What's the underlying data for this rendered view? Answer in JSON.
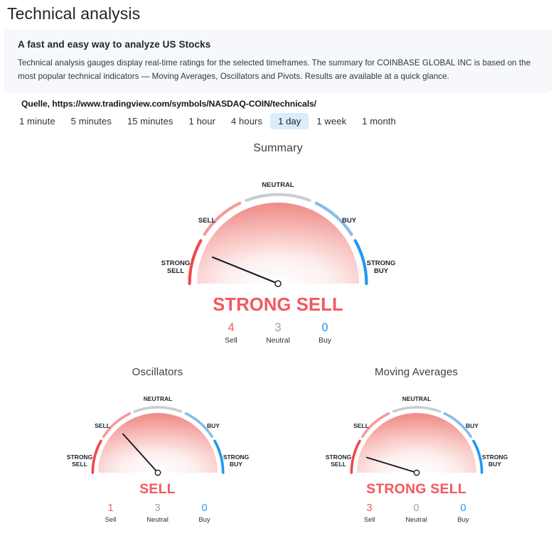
{
  "page_title": "Technical analysis",
  "info": {
    "heading": "A fast and easy way to analyze US Stocks",
    "body": "Technical analysis gauges display real-time ratings for the selected timeframes. The summary for COINBASE GLOBAL INC is based on the most popular technical indicators — Moving Averages, Oscillators and Pivots. Results are available at a quick glance."
  },
  "source": {
    "label": "Quelle, https://www.tradingview.com/symbols/NASDAQ-COIN/technicals/"
  },
  "timeframes": {
    "options": [
      "1 minute",
      "5 minutes",
      "15 minutes",
      "1 hour",
      "4 hours",
      "1 day",
      "1 week",
      "1 month"
    ],
    "selected": "1 day"
  },
  "colors": {
    "strong_sell": "#f0484d",
    "sell": "#f59a9c",
    "neutral": "#c9cdd3",
    "buy": "#85bdec",
    "strong_buy": "#2196f3",
    "verdict_red": "#f3585c",
    "tab_active_bg": "#daedfb",
    "card_bg": "#f6f8fb"
  },
  "arc_labels": {
    "strong_sell": [
      "STRONG",
      "SELL"
    ],
    "sell": "SELL",
    "neutral": "NEUTRAL",
    "buy": "BUY",
    "strong_buy": [
      "STRONG",
      "BUY"
    ]
  },
  "count_labels": {
    "sell": "Sell",
    "neutral": "Neutral",
    "buy": "Buy"
  },
  "gauges": [
    {
      "id": "summary",
      "title": "Summary",
      "verdict": "STRONG SELL",
      "needle_angle_deg": 158,
      "counts": {
        "sell": "4",
        "neutral": "3",
        "buy": "0"
      }
    },
    {
      "id": "oscillators",
      "title": "Oscillators",
      "verdict": "SELL",
      "needle_angle_deg": 132,
      "counts": {
        "sell": "1",
        "neutral": "3",
        "buy": "0"
      }
    },
    {
      "id": "moving_averages",
      "title": "Moving Averages",
      "verdict": "STRONG SELL",
      "needle_angle_deg": 163,
      "counts": {
        "sell": "3",
        "neutral": "0",
        "buy": "0"
      }
    }
  ],
  "chart_data": {
    "type": "gauge",
    "title": "Technical analysis ratings",
    "scale": [
      "STRONG SELL",
      "SELL",
      "NEUTRAL",
      "BUY",
      "STRONG BUY"
    ],
    "timeframe": "1 day",
    "symbol": "COINBASE GLOBAL INC",
    "gauges": [
      {
        "name": "Summary",
        "rating": "STRONG SELL",
        "needle_angle_deg": 158,
        "sell": 4,
        "neutral": 3,
        "buy": 0
      },
      {
        "name": "Oscillators",
        "rating": "SELL",
        "needle_angle_deg": 132,
        "sell": 1,
        "neutral": 3,
        "buy": 0
      },
      {
        "name": "Moving Averages",
        "rating": "STRONG SELL",
        "needle_angle_deg": 163,
        "sell": 3,
        "neutral": 0,
        "buy": 0
      }
    ]
  }
}
